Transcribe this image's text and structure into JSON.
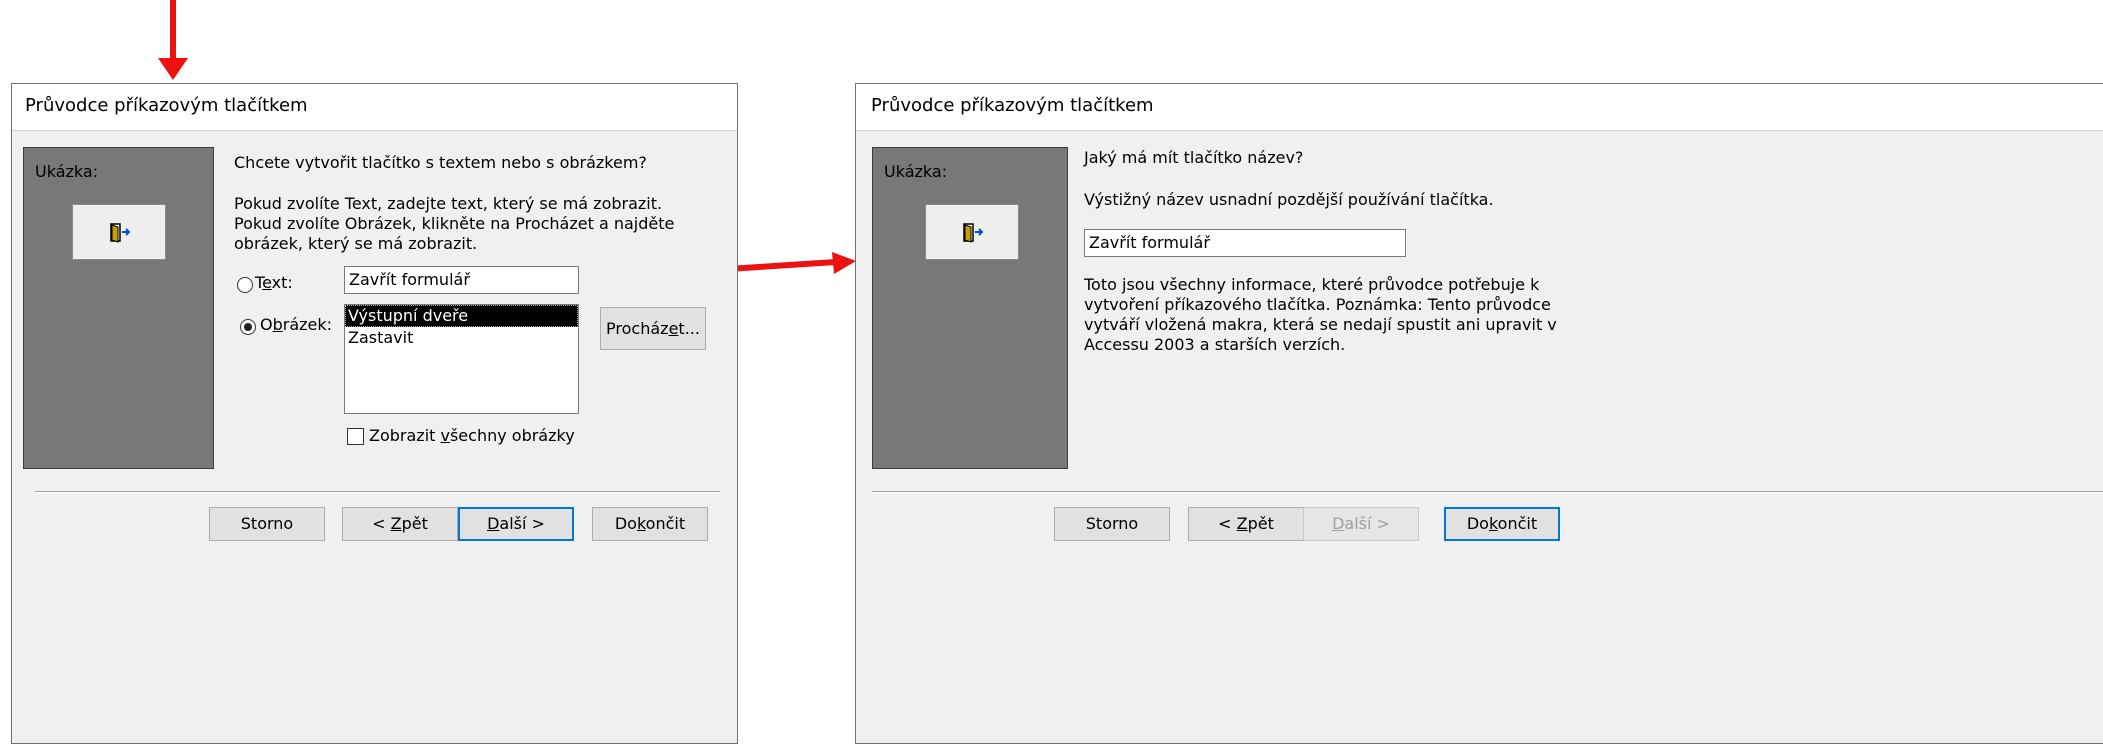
{
  "left_dialog": {
    "title": "Průvodce příkazovým tlačítkem",
    "preview_label": "Ukázka:",
    "question": "Chcete vytvořit tlačítko s textem nebo s obrázkem?",
    "instructions": "Pokud zvolíte Text, zadejte text, který se má zobrazit. Pokud zvolíte Obrázek, klikněte na Procházet a najděte obrázek, který se má zobrazit.",
    "text_option": {
      "pre": "T",
      "accel": "e",
      "post": "xt:",
      "selected": false
    },
    "text_value": "Zavřít formulář",
    "picture_option": {
      "pre": "O",
      "accel": "b",
      "post": "rázek:",
      "selected": true
    },
    "picture_list": [
      {
        "label": "Výstupní dveře",
        "selected": true
      },
      {
        "label": "Zastavit",
        "selected": false
      }
    ],
    "browse_button": {
      "pre": "Procház",
      "accel": "e",
      "post": "t..."
    },
    "show_all_checkbox": {
      "pre": "Zobrazit ",
      "accel": "v",
      "post": "šechny obrázky",
      "checked": false
    },
    "buttons": {
      "cancel": {
        "pre": "Storno",
        "accel": "",
        "post": ""
      },
      "back": {
        "pre": "< ",
        "accel": "Z",
        "post": "pět"
      },
      "next": {
        "pre": "",
        "accel": "D",
        "post": "alší >"
      },
      "finish": {
        "pre": "Do",
        "accel": "k",
        "post": "ončit"
      }
    }
  },
  "right_dialog": {
    "title": "Průvodce příkazovým tlačítkem",
    "preview_label": "Ukázka:",
    "question": "Jaký má mít tlačítko název?",
    "hint": "Výstižný název usnadní pozdější používání tlačítka.",
    "name_value": "Zavřít formulář",
    "info": "Toto jsou všechny informace, které průvodce potřebuje k vytvoření příkazového tlačítka. Poznámka: Tento průvodce vytváří vložená makra, která se nedají spustit ani upravit v Accessu 2003 a starších verzích.",
    "buttons": {
      "cancel": {
        "pre": "Storno",
        "accel": "",
        "post": ""
      },
      "back": {
        "pre": "< ",
        "accel": "Z",
        "post": "pět"
      },
      "next": {
        "pre": "",
        "accel": "D",
        "post": "alší >",
        "disabled": true
      },
      "finish": {
        "pre": "Do",
        "accel": "k",
        "post": "ončit"
      }
    }
  },
  "colors": {
    "annotation_arrow": "#ee1111",
    "preview_panel": "#787878",
    "dialog_bg": "#f0f0f0",
    "default_button_border": "#0078d7"
  },
  "icons": {
    "sample_button_icon": "exit-door-icon",
    "annotation": "red-arrow"
  }
}
